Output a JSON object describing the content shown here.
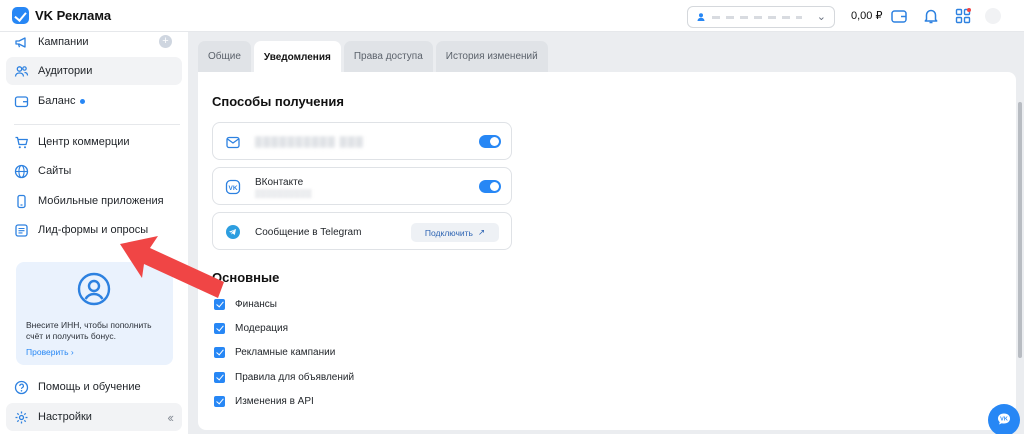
{
  "header": {
    "app_title": "VK Реклама",
    "balance": "0,00 ₽"
  },
  "sidebar": {
    "items": [
      {
        "label": "Кампании"
      },
      {
        "label": "Аудитории"
      },
      {
        "label": "Баланс"
      },
      {
        "label": "Центр коммерции"
      },
      {
        "label": "Сайты"
      },
      {
        "label": "Мобильные приложения"
      },
      {
        "label": "Лид-формы и опросы"
      }
    ],
    "promo": {
      "text": "Внесите ИНН, чтобы пополнить счёт и получить бонус.",
      "link": "Проверить"
    },
    "help_label": "Помощь и обучение",
    "settings_label": "Настройки"
  },
  "tabs": [
    {
      "label": "Общие",
      "active": false
    },
    {
      "label": "Уведомления",
      "active": true
    },
    {
      "label": "Права доступа",
      "active": false
    },
    {
      "label": "История изменений",
      "active": false
    }
  ],
  "delivery": {
    "title": "Способы получения",
    "email": {
      "value": "▒▒▒▒▒▒▒▒▒▒ ▒▒▒",
      "enabled": true
    },
    "vk": {
      "title": "ВКонтакте",
      "subtitle": "▒▒▒▒▒▒▒▒▒▒",
      "enabled": true
    },
    "telegram": {
      "title": "Сообщение в Telegram",
      "connect_label": "Подключить"
    }
  },
  "main_notifications": {
    "title": "Основные",
    "items": [
      {
        "label": "Финансы",
        "checked": true
      },
      {
        "label": "Модерация",
        "checked": true
      },
      {
        "label": "Рекламные кампании",
        "checked": true
      },
      {
        "label": "Правила для объявлений",
        "checked": true
      },
      {
        "label": "Изменения в API",
        "checked": true
      }
    ]
  },
  "colors": {
    "accent": "#2787f5",
    "arrow": "#f04545"
  }
}
